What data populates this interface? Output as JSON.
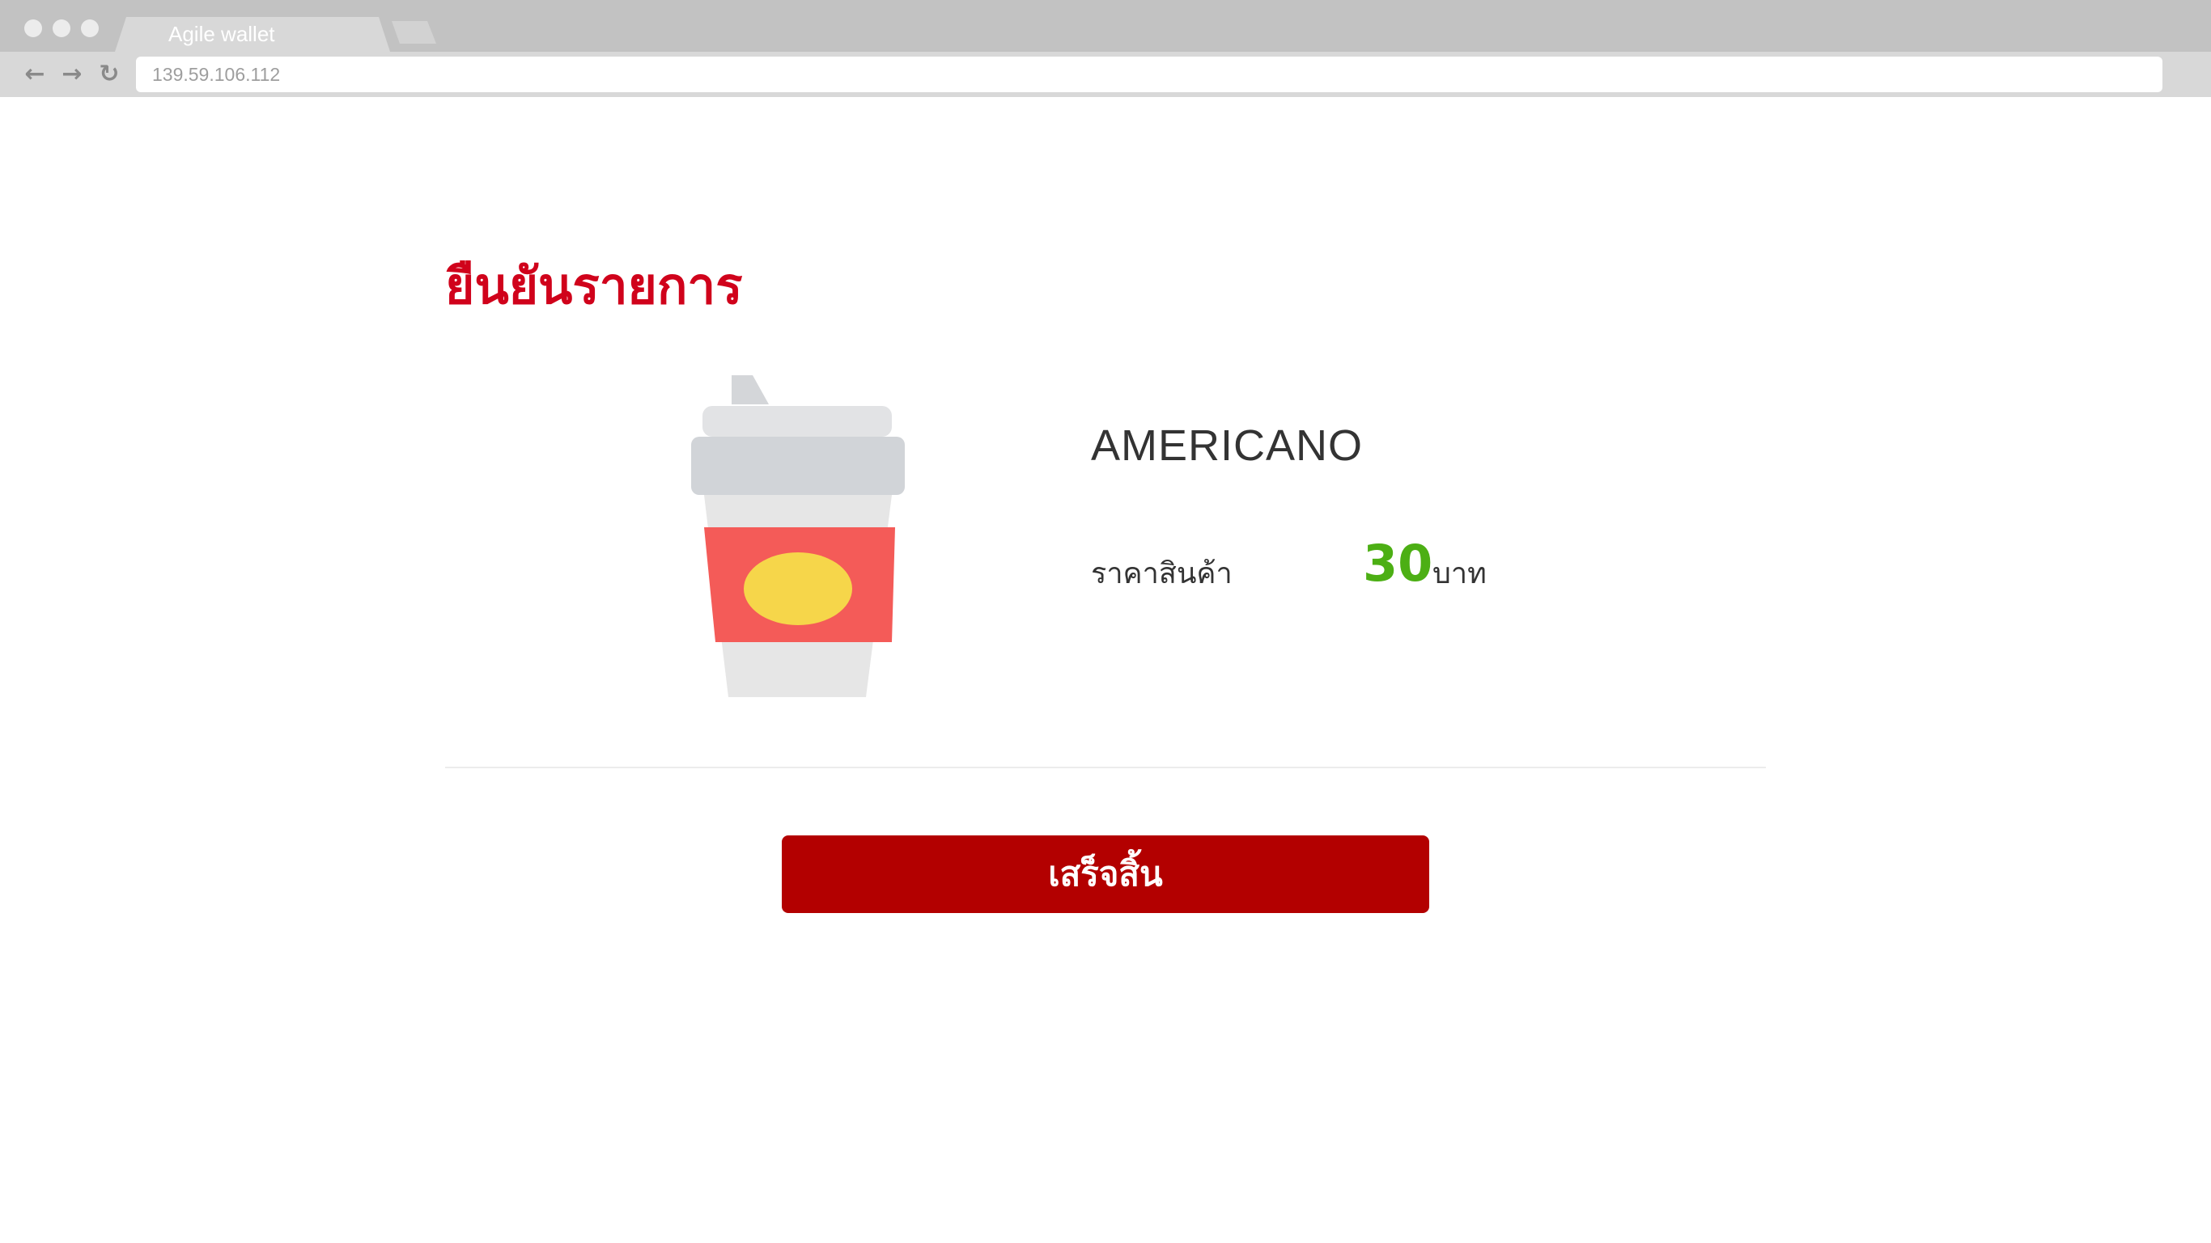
{
  "browser": {
    "tab_title": "Agile wallet",
    "address": "139.59.106.112",
    "icons": [
      "back-arrow-icon",
      "forward-arrow-icon",
      "reload-icon"
    ]
  },
  "page": {
    "title": "ยืนยันรายการ"
  },
  "product": {
    "name": "AMERICANO",
    "price_label": "ราคาสินค้า",
    "price_value": "30",
    "price_unit": "บาท",
    "image_icon": "coffee-cup-icon"
  },
  "actions": {
    "done_label": "เสร็จสิ้น"
  },
  "colors": {
    "title": "#d0021b",
    "price": "#4caf14",
    "button": "#b30000",
    "cup_sleeve": "#f45b58",
    "cup_logo": "#f6d64a"
  }
}
